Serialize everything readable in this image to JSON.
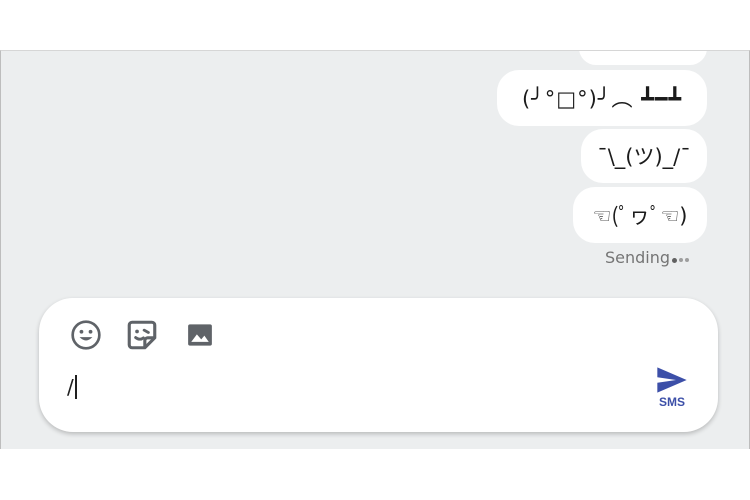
{
  "messages": [
    {
      "text": "(╯°□°)╯︵ ┻━┻"
    },
    {
      "text": "¯\\_(ツ)_/¯"
    },
    {
      "text": "☜(ﾟヮﾟ☜)"
    }
  ],
  "status": {
    "sending_label": "Sending"
  },
  "composer": {
    "input_value": "/",
    "send_label": "SMS",
    "icons": {
      "emoji": "emoji-icon",
      "sticker": "sticker-icon",
      "image": "image-icon",
      "send": "send-icon"
    }
  },
  "colors": {
    "background": "#eceeef",
    "bubble": "#ffffff",
    "accent": "#3c4fa8",
    "icon": "#5f6368"
  }
}
